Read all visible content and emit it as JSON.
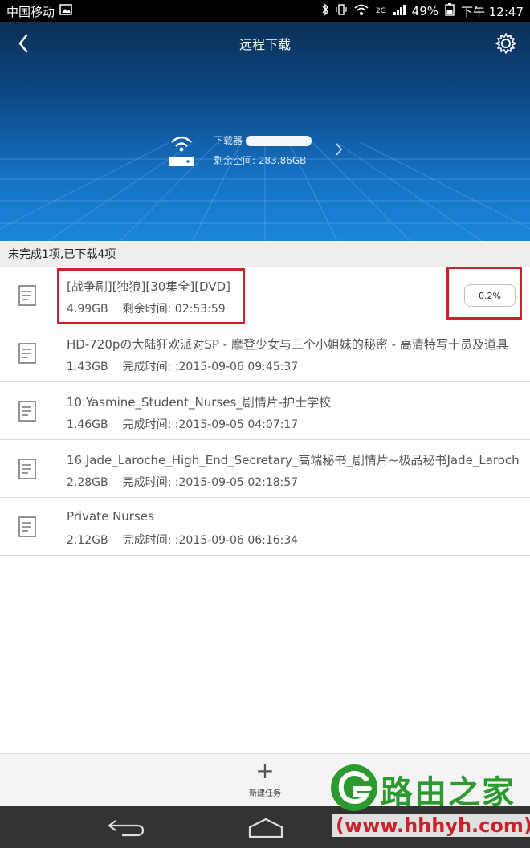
{
  "status_bar": {
    "carrier": "中国移动",
    "network": "2G",
    "battery": "49%",
    "time": "下午 12:47"
  },
  "header": {
    "title": "远程下载",
    "device_label": "下载器",
    "free_space": "剩余空间: 283.86GB"
  },
  "summary": "未完成1项,已下载4项",
  "downloads": [
    {
      "name": "[战争剧][独狼][30集全][DVD]",
      "size": "4.99GB",
      "status": "剩余时间: 02:53:59",
      "progress": "0.2%"
    },
    {
      "name": "HD-720pの大陆狂欢派对SP - 摩登少女与三个小姐妹的秘密 - 高清特写十员及道具",
      "size": "1.43GB",
      "status": "完成时间: :2015-09-06 09:45:37"
    },
    {
      "name": "10.Yasmine_Student_Nurses_剧情片-护士学校",
      "size": "1.46GB",
      "status": "完成时间: :2015-09-05 04:07:17"
    },
    {
      "name": "16.Jade_Laroche_High_End_Secretary_高端秘书_剧情片~极品秘书Jade_Laroche",
      "size": "2.28GB",
      "status": "完成时间: :2015-09-05 02:18:57"
    },
    {
      "name": "Private Nurses",
      "size": "2.12GB",
      "status": "完成时间: :2015-09-06 06:16:34"
    }
  ],
  "bottom": {
    "new_task": "新建任务"
  },
  "watermark": {
    "brand": "路由之家",
    "url": "(www.hhhyh.com)"
  }
}
